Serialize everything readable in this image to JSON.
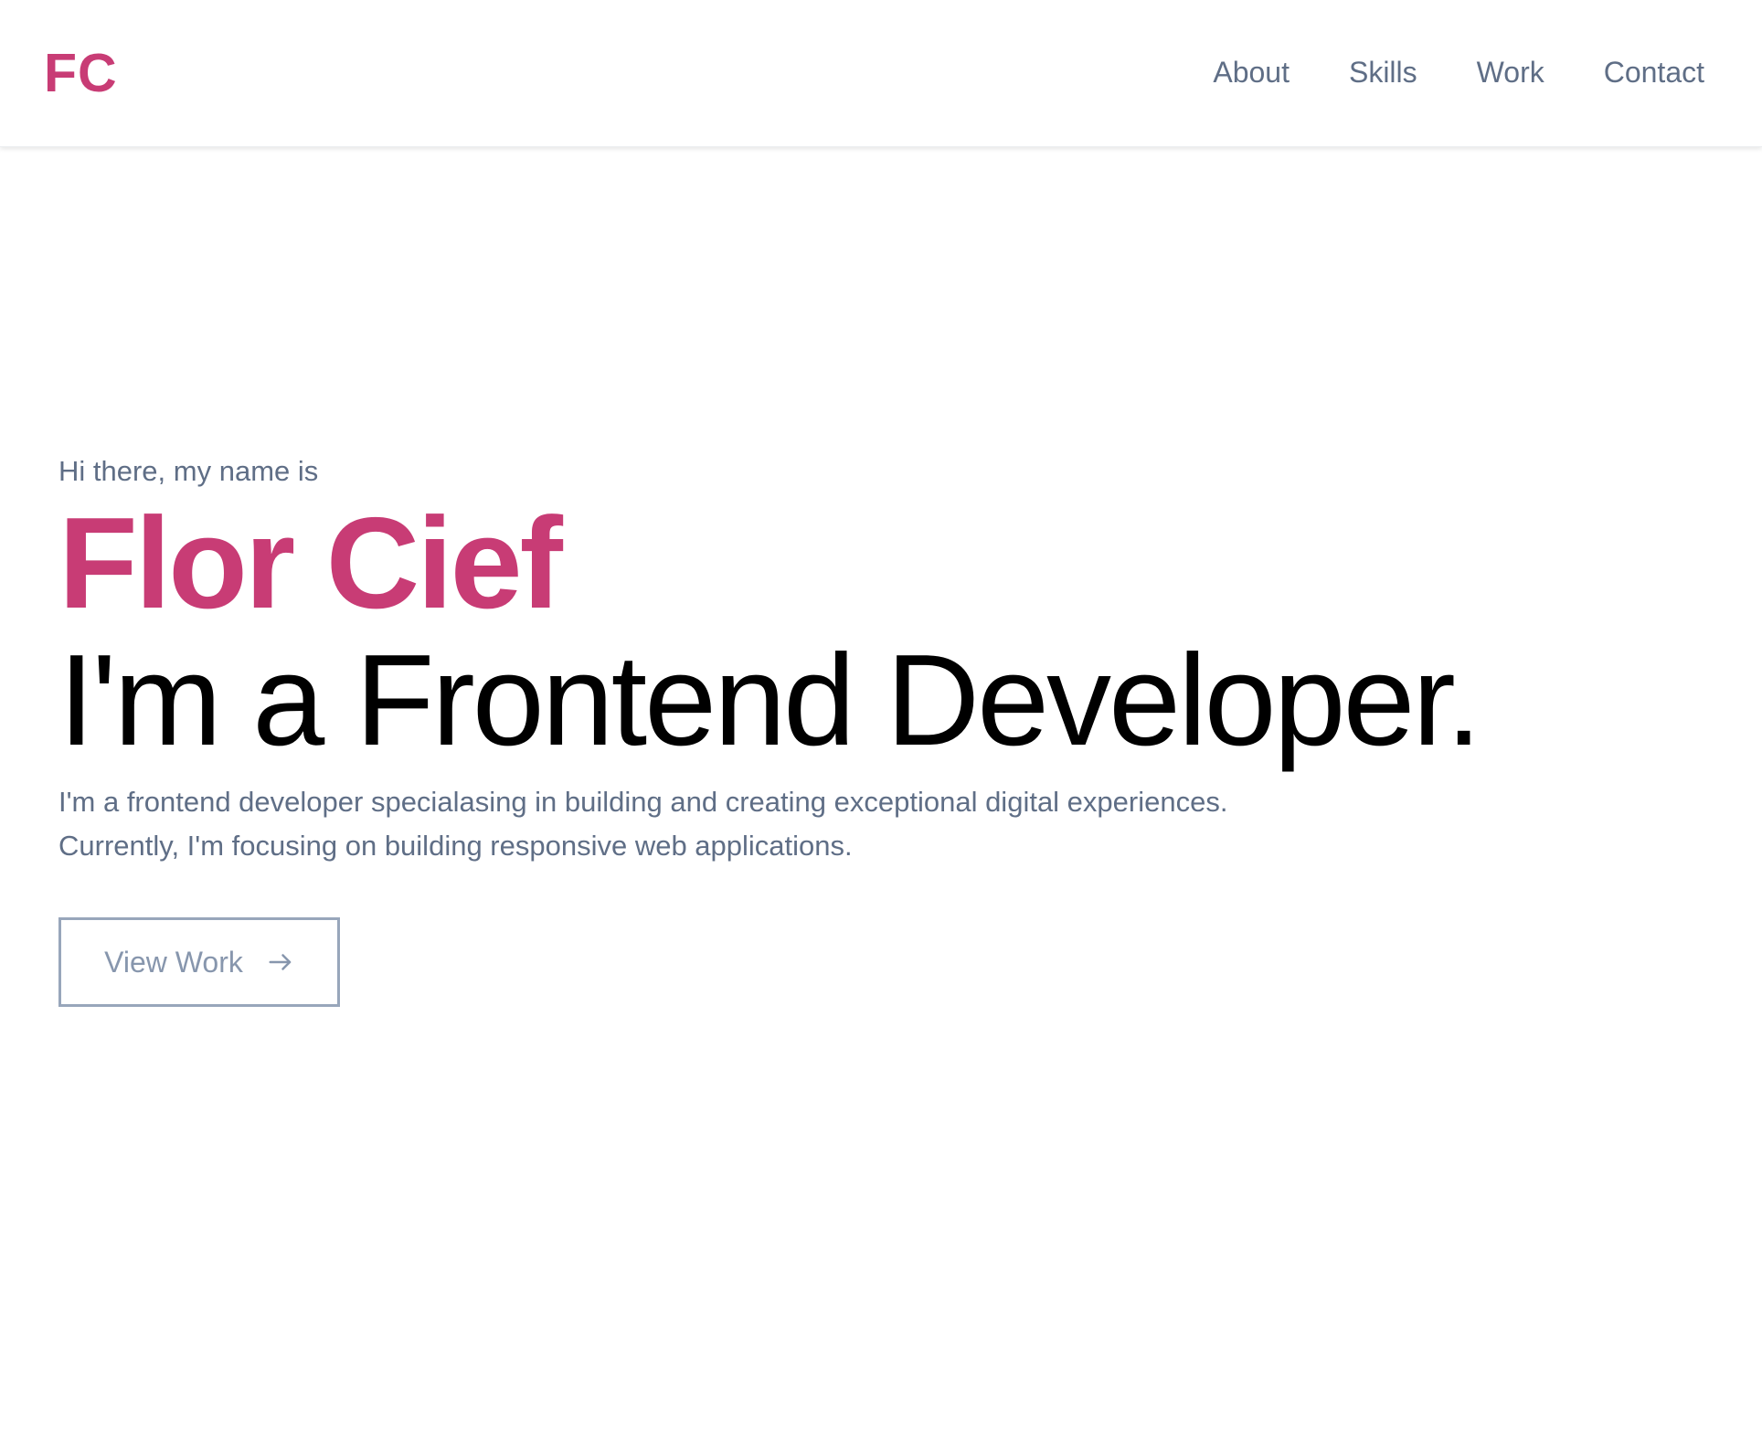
{
  "header": {
    "logo": "FC",
    "nav": [
      {
        "label": "About"
      },
      {
        "label": "Skills"
      },
      {
        "label": "Work"
      },
      {
        "label": "Contact"
      }
    ]
  },
  "hero": {
    "greeting": "Hi there, my name is",
    "name": "Flor Cief",
    "role": "I'm a Frontend Developer.",
    "description_lines": [
      "I'm a frontend developer specialasing in building and creating exceptional digital experiences.",
      "Currently, I'm focusing on building responsive web applications."
    ],
    "cta_label": "View Work",
    "cta_icon": "arrow-right-icon"
  },
  "colors": {
    "accent": "#c83c75",
    "muted_text": "#5f6e86",
    "button_border": "#98a6bb",
    "background": "#ffffff"
  }
}
